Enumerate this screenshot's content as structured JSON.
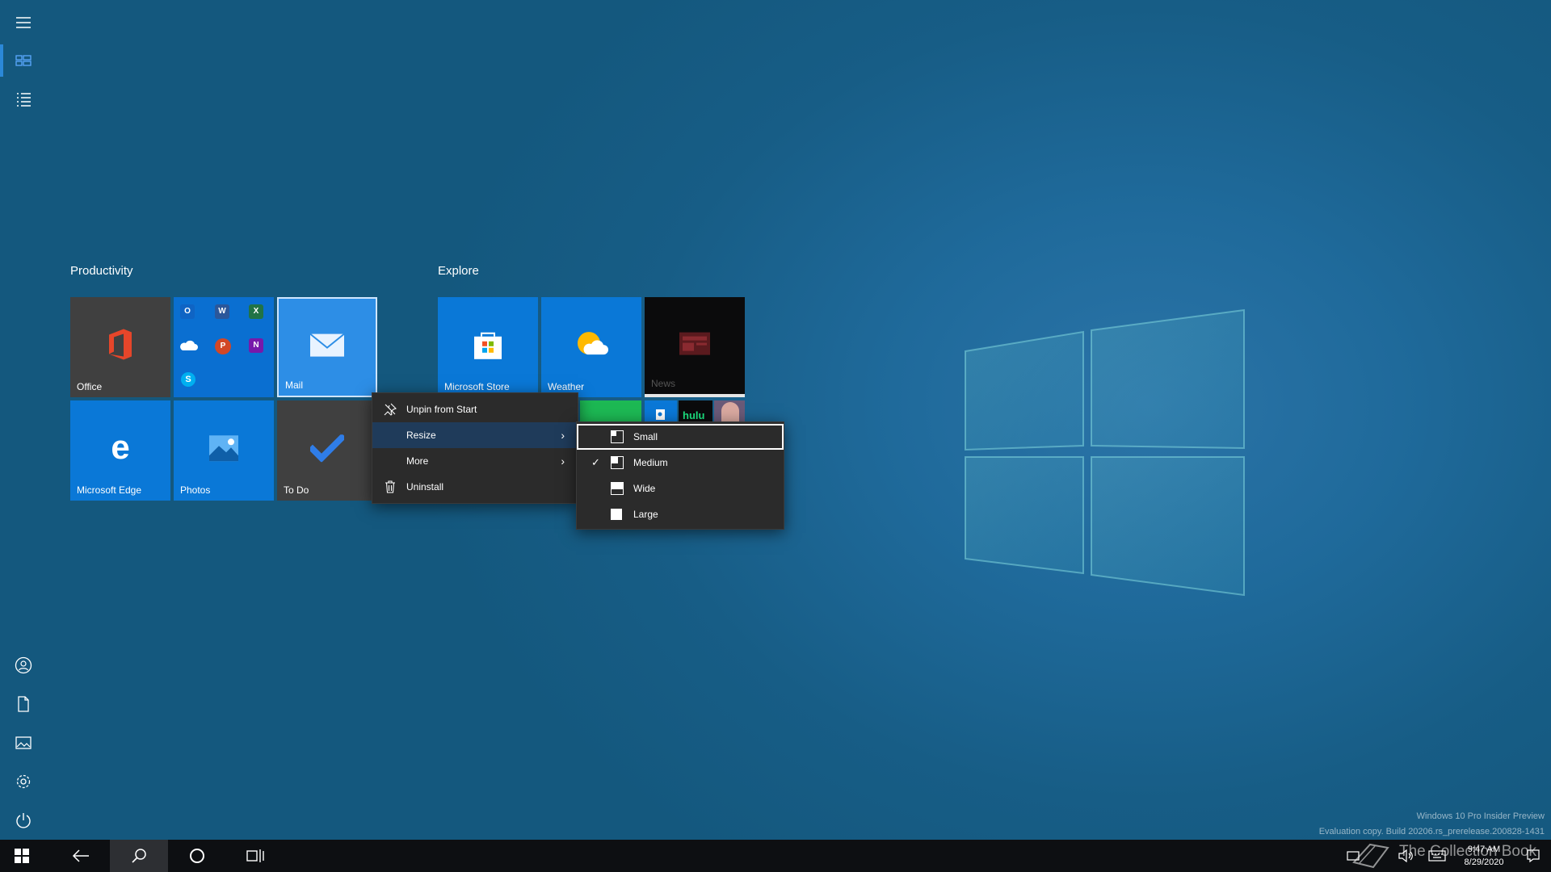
{
  "start": {
    "groups": [
      {
        "title": "Productivity"
      },
      {
        "title": "Explore"
      }
    ],
    "tiles": {
      "office": "Office",
      "mail": "Mail",
      "edge": "Microsoft Edge",
      "photos": "Photos",
      "todo": "To Do",
      "store": "Microsoft Store",
      "weather": "Weather",
      "news": "News",
      "hulu": "hulu"
    }
  },
  "context_menu": {
    "items": [
      {
        "label": "Unpin from Start",
        "icon": "unpin-icon"
      },
      {
        "label": "Resize",
        "icon": "",
        "submenu": true
      },
      {
        "label": "More",
        "icon": "",
        "submenu": true
      },
      {
        "label": "Uninstall",
        "icon": "trash-icon"
      }
    ],
    "highlighted": "Resize"
  },
  "resize_submenu": {
    "items": [
      {
        "label": "Small",
        "checked": false
      },
      {
        "label": "Medium",
        "checked": true
      },
      {
        "label": "Wide",
        "checked": false
      },
      {
        "label": "Large",
        "checked": false
      }
    ],
    "focused": "Small"
  },
  "taskbar": {
    "time": "9:47 AM",
    "date": "8/29/2020"
  },
  "watermark": {
    "line1": "Windows 10 Pro Insider Preview",
    "line2": "Evaluation copy. Build 20206.rs_prerelease.200828-1431",
    "overlay": "The Collection Book"
  },
  "colors": {
    "accent": "#0078d7",
    "menu_bg": "#2b2b2b",
    "taskbar_bg": "#0d0f12"
  }
}
